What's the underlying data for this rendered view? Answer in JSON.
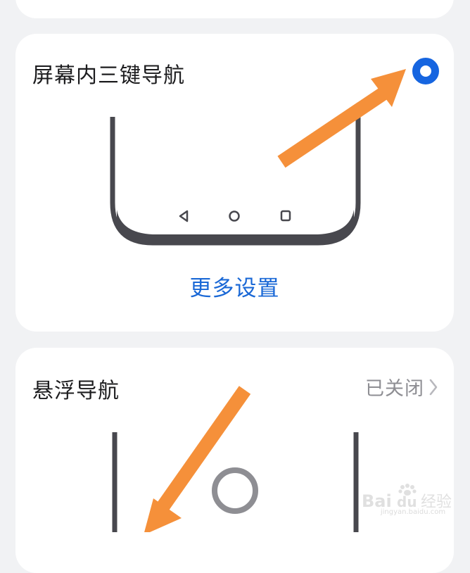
{
  "three_key_nav": {
    "title": "屏幕内三键导航",
    "selected": true,
    "more_settings": "更多设置"
  },
  "floating_nav": {
    "title": "悬浮导航",
    "status": "已关闭"
  },
  "watermark": {
    "brand": "Bai",
    "brand_suffix": "du",
    "label": "经验",
    "url": "jingyan.baidu.com"
  },
  "colors": {
    "accent_blue": "#1665e0",
    "annotation_arrow": "#f5903a",
    "phone_frame": "#48484e"
  },
  "icons": {
    "back": "triangle-back-icon",
    "home": "circle-home-icon",
    "recent": "square-recent-icon",
    "chevron": "chevron-right-icon"
  }
}
